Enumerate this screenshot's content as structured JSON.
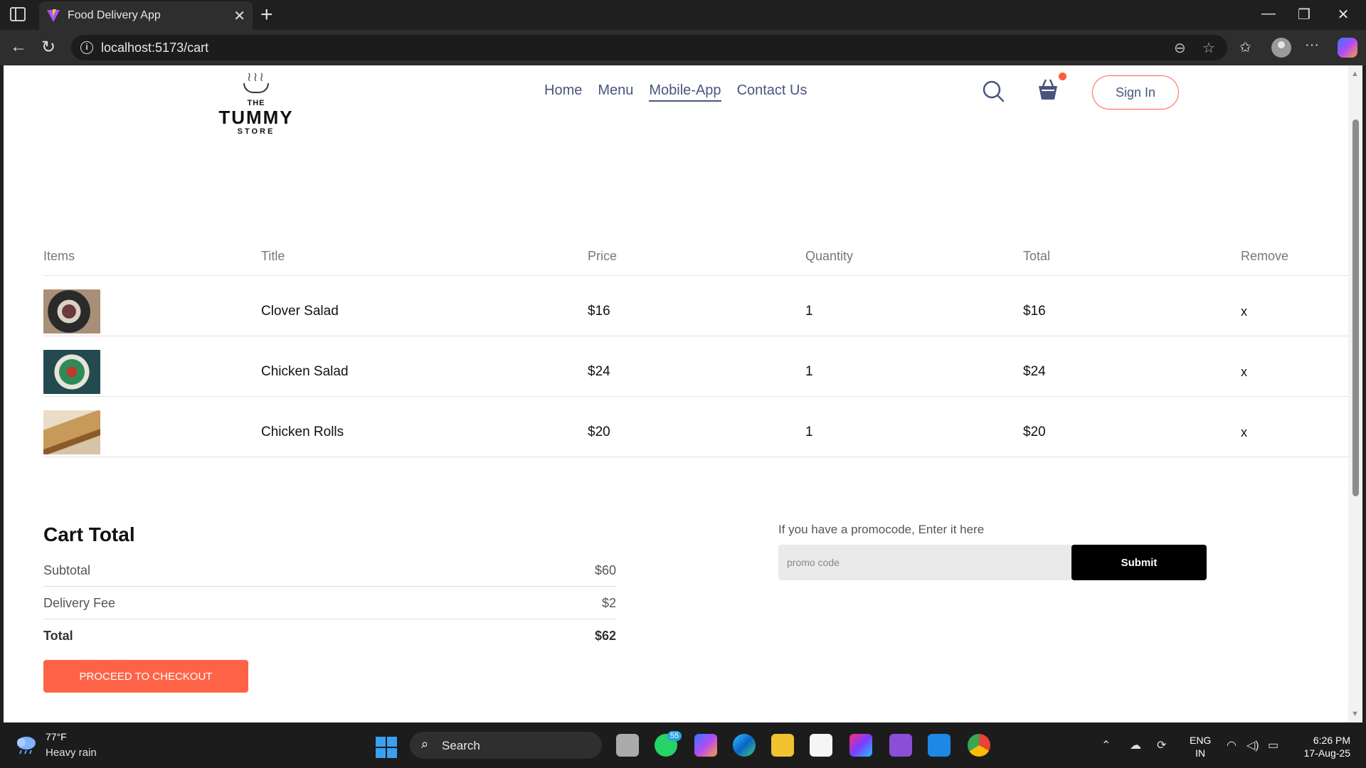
{
  "browser": {
    "tab_title": "Food Delivery App",
    "url": "localhost:5173/cart"
  },
  "header": {
    "logo": {
      "top": "THE",
      "main": "TUMMY",
      "bottom": "STORE"
    },
    "nav": [
      "Home",
      "Menu",
      "Mobile-App",
      "Contact Us"
    ],
    "active_nav": "Mobile-App",
    "sign_in_label": "Sign In",
    "accent_color": "#ff6347",
    "nav_color": "#49557e"
  },
  "cart": {
    "columns": [
      "Items",
      "Title",
      "Price",
      "Quantity",
      "Total",
      "Remove"
    ],
    "rows": [
      {
        "title": "Clover Salad",
        "price": "$16",
        "quantity": "1",
        "total": "$16",
        "remove": "x"
      },
      {
        "title": "Chicken Salad",
        "price": "$24",
        "quantity": "1",
        "total": "$24",
        "remove": "x"
      },
      {
        "title": "Chicken Rolls",
        "price": "$20",
        "quantity": "1",
        "total": "$20",
        "remove": "x"
      }
    ]
  },
  "cart_total": {
    "heading": "Cart Total",
    "subtotal_label": "Subtotal",
    "subtotal": "$60",
    "delivery_label": "Delivery Fee",
    "delivery": "$2",
    "total_label": "Total",
    "total": "$62",
    "checkout_label": "PROCEED TO CHECKOUT"
  },
  "promo": {
    "label": "If you have a promocode, Enter it here",
    "placeholder": "promo code",
    "submit_label": "Submit"
  },
  "taskbar": {
    "weather_temp": "77°F",
    "weather_desc": "Heavy rain",
    "search_label": "Search",
    "whatsapp_badge": "55",
    "lang_top": "ENG",
    "lang_bottom": "IN",
    "time": "6:26 PM",
    "date": "17-Aug-25"
  }
}
